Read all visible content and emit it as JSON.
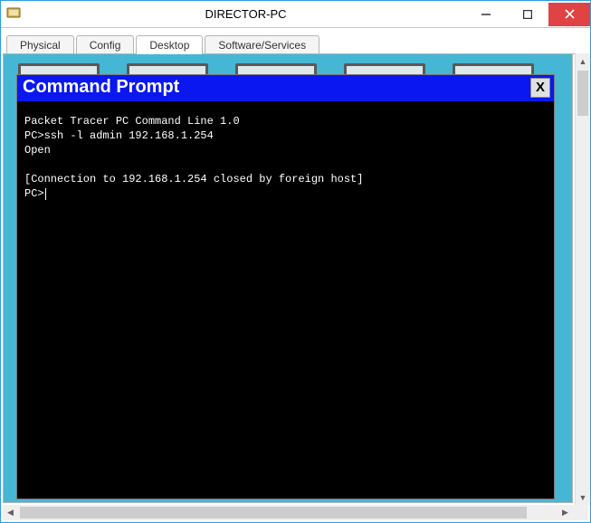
{
  "window": {
    "title": "DIRECTOR-PC"
  },
  "tabs": [
    {
      "label": "Physical"
    },
    {
      "label": "Config"
    },
    {
      "label": "Desktop"
    },
    {
      "label": "Software/Services"
    }
  ],
  "active_tab_index": 2,
  "command_prompt": {
    "title": "Command Prompt",
    "close_label": "X",
    "lines": {
      "l0": "Packet Tracer PC Command Line 1.0",
      "l1": "PC>ssh -l admin 192.168.1.254",
      "l2": "Open",
      "l3": "",
      "l4": "[Connection to 192.168.1.254 closed by foreign host]",
      "l5": "PC>"
    }
  }
}
